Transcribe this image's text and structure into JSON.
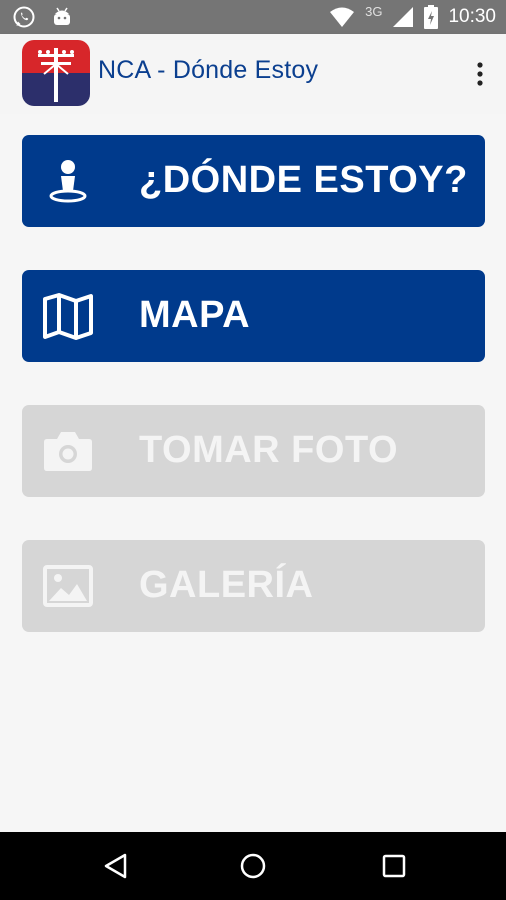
{
  "status_bar": {
    "network": "3G",
    "time": "10:30",
    "icons": [
      "whatsapp-icon",
      "android-icon",
      "wifi-icon",
      "signal-icon",
      "battery-icon"
    ]
  },
  "app_bar": {
    "title": "NCA - Dónde Estoy",
    "logo_icon": "utility-pole-logo",
    "menu_icon": "more-vert-icon"
  },
  "buttons": [
    {
      "label": "¿DÓNDE ESTOY?",
      "icon": "person-pin-icon",
      "state": "enabled"
    },
    {
      "label": "MAPA",
      "icon": "map-icon",
      "state": "enabled"
    },
    {
      "label": "TOMAR FOTO",
      "icon": "camera-icon",
      "state": "disabled"
    },
    {
      "label": "GALERÍA",
      "icon": "image-icon",
      "state": "disabled"
    }
  ],
  "nav_bar": {
    "icons": [
      "back-icon",
      "home-icon",
      "recents-icon"
    ]
  },
  "colors": {
    "primary": "#003a8c",
    "title_text": "#0b3f8f",
    "disabled_bg": "#d6d6d6",
    "logo_red": "#d7262a",
    "logo_navy": "#2c2f6b"
  }
}
